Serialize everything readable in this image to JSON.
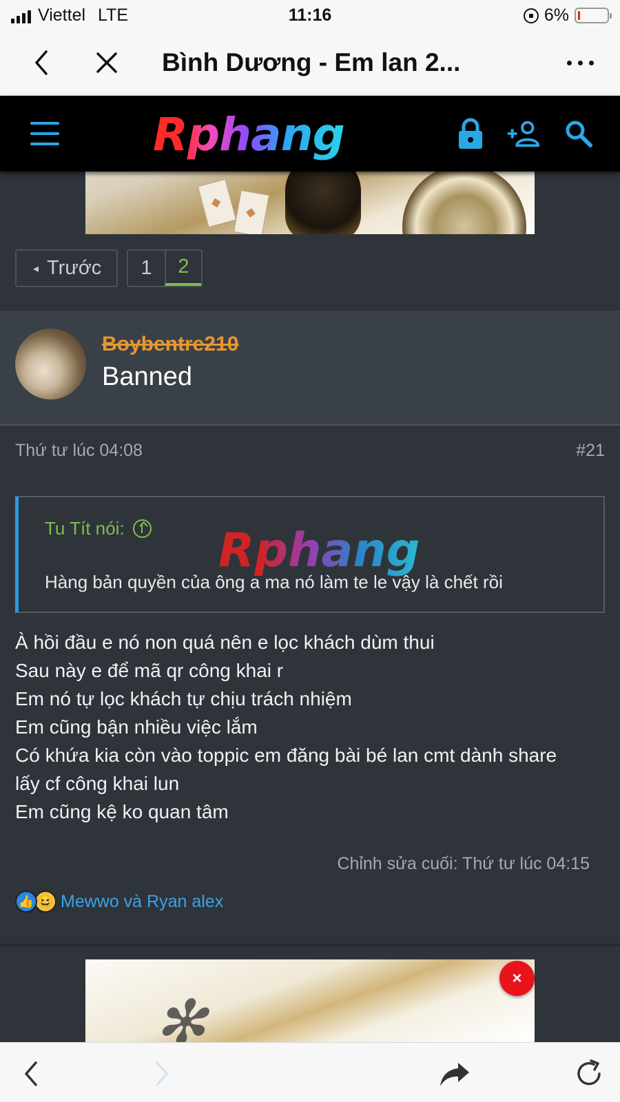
{
  "status_bar": {
    "carrier": "Viettel",
    "network": "LTE",
    "time": "11:16",
    "battery": "6%"
  },
  "browser": {
    "page_title": "Bình Dương - Em lan 2...",
    "icons": [
      "back-icon",
      "close-icon",
      "more-icon"
    ]
  },
  "site": {
    "logo_text": "Rphang",
    "accent_color": "#29a8e6",
    "header_icons": [
      "menu-icon",
      "lock-icon",
      "add-user-icon",
      "search-icon"
    ]
  },
  "pagination": {
    "prev_label": "Trước",
    "pages": [
      "1",
      "2"
    ],
    "current_page": "2"
  },
  "post": {
    "username": "Boybentre210",
    "user_title": "Banned",
    "timestamp": "Thứ tư lúc 04:08",
    "post_number": "#21",
    "quote": {
      "author_label": "Tu Tít nói:",
      "watermark": "Rphang",
      "text": "Hàng bản quyền của ông a ma nó làm te le vậy là chết rồi"
    },
    "body_lines": [
      "À hồi đầu e nó non quá nên e lọc khách dùm thui",
      "Sau này e để mã qr công khai r",
      "Em nó tự lọc khách tự chịu trách nhiệm",
      "Em cũng bận nhiều việc lắm",
      "Có khứa kia còn vào toppic em đăng bài bé lan cmt dành share",
      "lấy cf công khai lun",
      "Em cũng kệ ko quan tâm"
    ],
    "edited_note": "Chỉnh sửa cuối: Thứ tư lúc 04:15",
    "reactions": {
      "icons": [
        "like-icon",
        "haha-icon"
      ],
      "reactors": "Mewwo và Ryan alex"
    }
  },
  "ad": {
    "close_label": "×"
  },
  "toolbar": {
    "icons": [
      "back-icon",
      "forward-icon",
      "share-icon",
      "reload-icon"
    ]
  }
}
